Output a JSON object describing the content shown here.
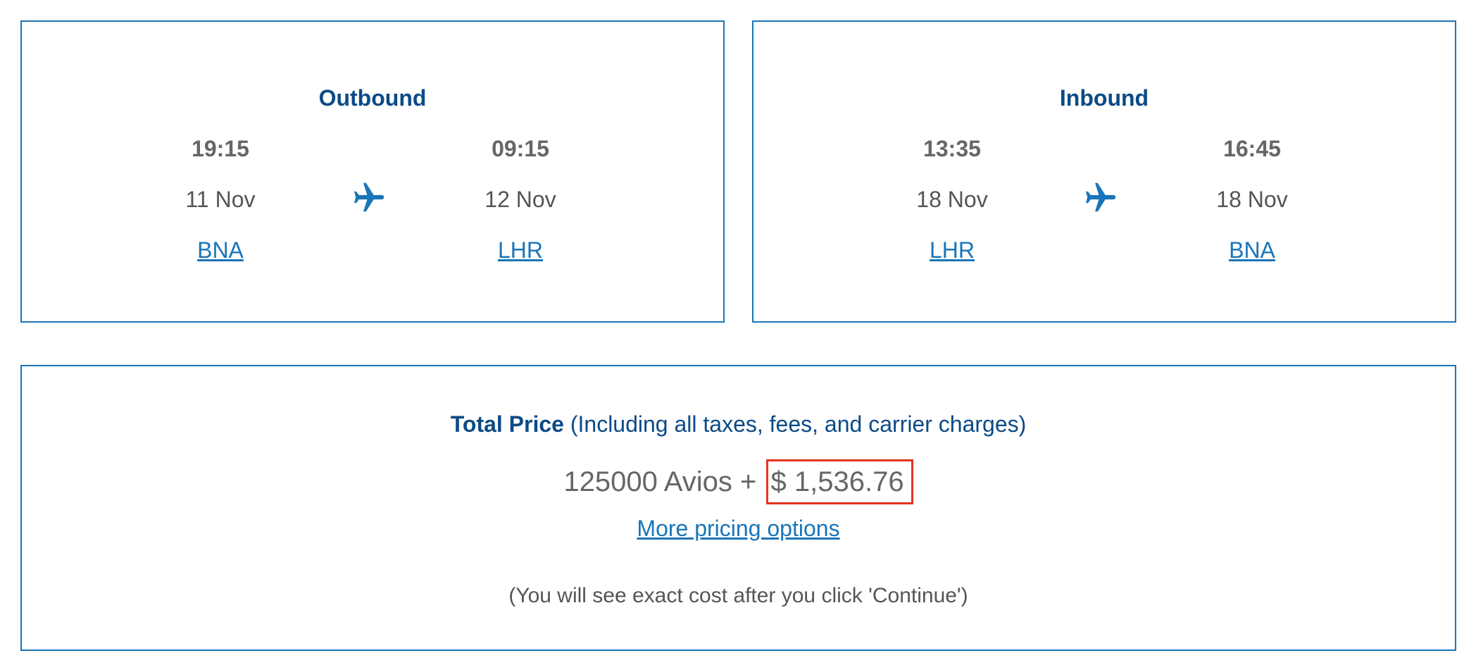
{
  "colors": {
    "accent": "#1a75b8",
    "heading": "#0b4a86",
    "highlight": "#e53222",
    "text": "#666666"
  },
  "outbound": {
    "heading": "Outbound",
    "depart": {
      "time": "19:15",
      "date": "11 Nov",
      "airport": "BNA"
    },
    "arrive": {
      "time": "09:15",
      "date": "12 Nov",
      "airport": "LHR"
    },
    "icon": "airplane-icon"
  },
  "inbound": {
    "heading": "Inbound",
    "depart": {
      "time": "13:35",
      "date": "18 Nov",
      "airport": "LHR"
    },
    "arrive": {
      "time": "16:45",
      "date": "18 Nov",
      "airport": "BNA"
    },
    "icon": "airplane-icon"
  },
  "price": {
    "label": "Total Price",
    "label_note": "(Including all taxes, fees, and carrier charges)",
    "avios": "125000 Avios +",
    "cash": "$ 1,536.76",
    "more_options_link": "More pricing options",
    "note": "(You will see exact cost after you click 'Continue')"
  }
}
